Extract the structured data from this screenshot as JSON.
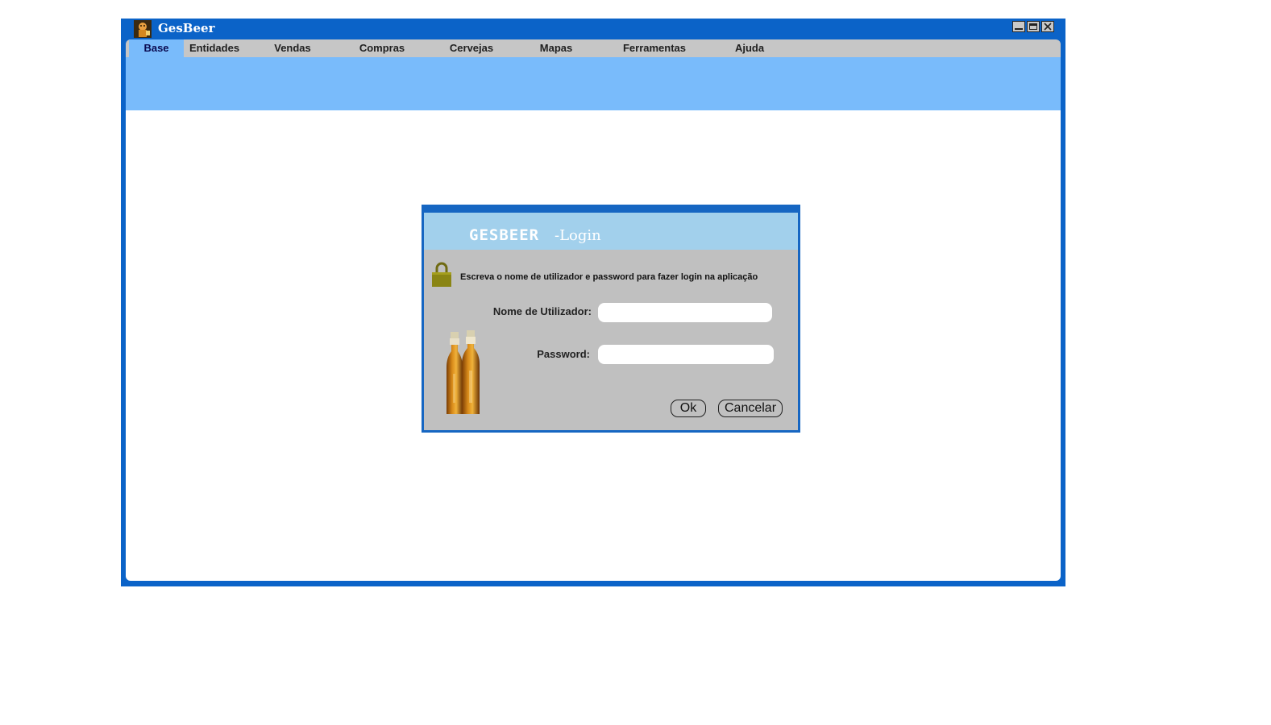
{
  "window": {
    "title": "GesBeer",
    "controls": [
      "minimize-icon",
      "maximize-icon",
      "close-icon"
    ]
  },
  "menu": {
    "items": [
      {
        "label": "Base",
        "active": true
      },
      {
        "label": "Entidades",
        "active": false
      },
      {
        "label": "Vendas",
        "active": false
      },
      {
        "label": "Compras",
        "active": false
      },
      {
        "label": "Cervejas",
        "active": false
      },
      {
        "label": "Mapas",
        "active": false
      },
      {
        "label": "Ferramentas",
        "active": false
      },
      {
        "label": "Ajuda",
        "active": false
      }
    ]
  },
  "login": {
    "brand": "GESBEER",
    "subtitle": "-Login",
    "instructions": "Escreva o nome de utilizador e password para fazer login na aplicação",
    "username_label": "Nome de Utilizador:",
    "username_value": "",
    "password_label": "Password:",
    "password_value": "",
    "ok_label": "Ok",
    "cancel_label": "Cancelar"
  },
  "colors": {
    "window_frame": "#0b63c8",
    "menu_bar": "#c6c6c6",
    "ribbon": "#79bbfb",
    "dialog_header": "#a2d0ec",
    "dialog_body": "#c0c0c0"
  }
}
